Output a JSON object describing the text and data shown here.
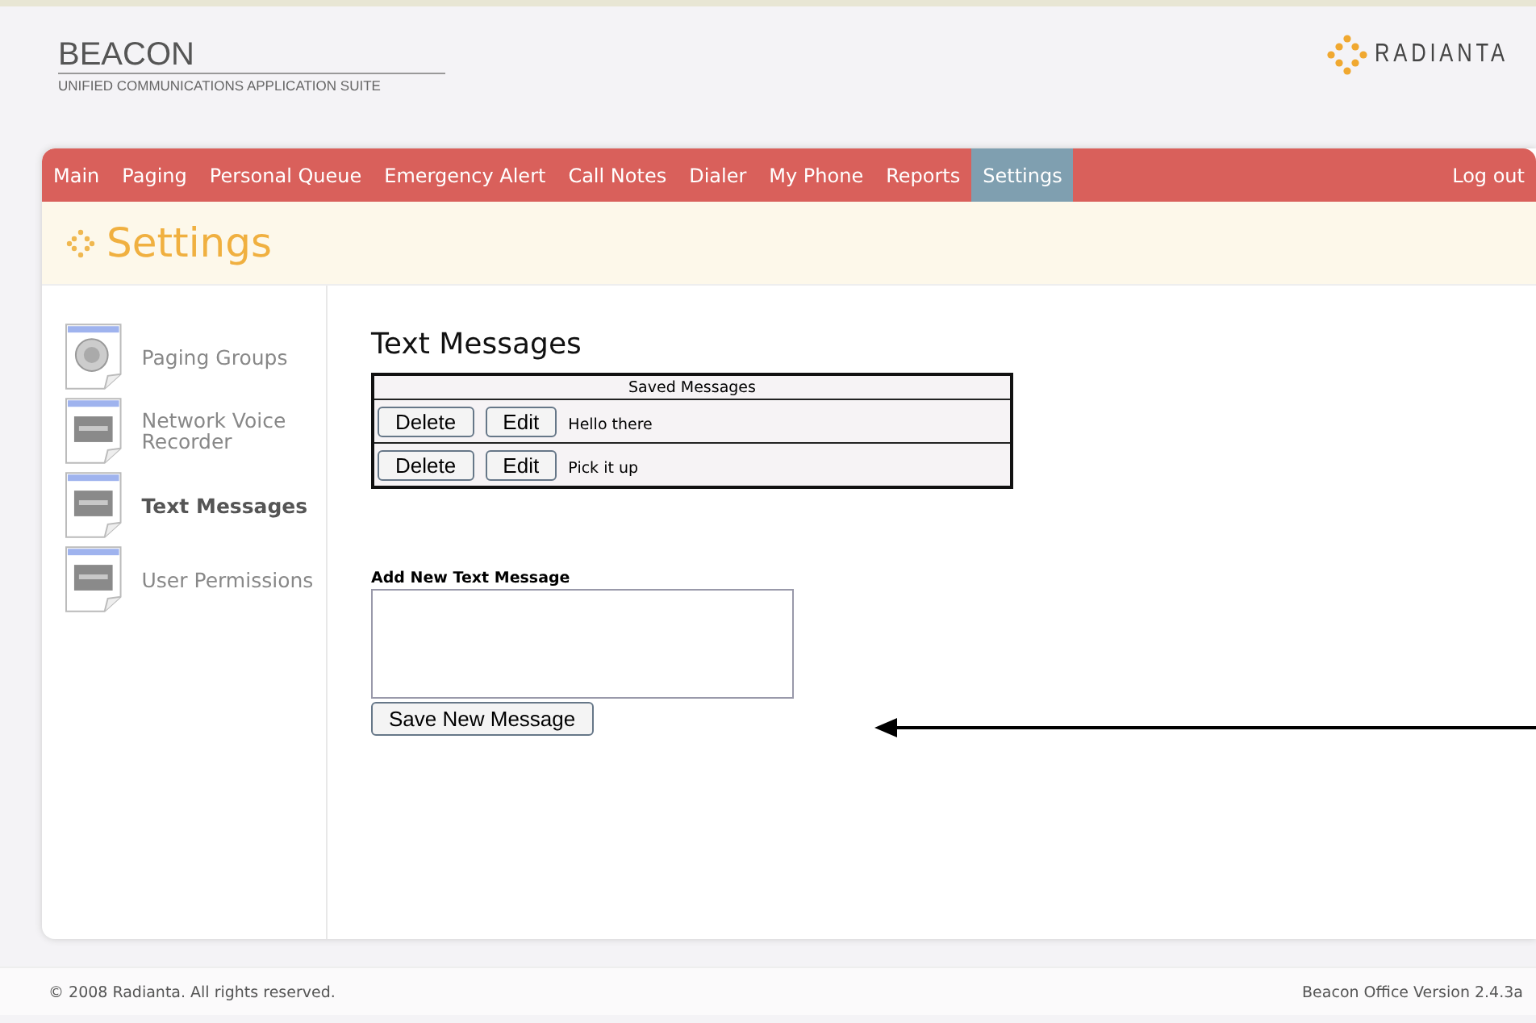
{
  "header": {
    "title": "BEACON",
    "subtitle": "UNIFIED COMMUNICATIONS APPLICATION SUITE",
    "brand": "RADIANTA"
  },
  "nav": [
    {
      "label": "Main",
      "selected": false
    },
    {
      "label": "Paging",
      "selected": false
    },
    {
      "label": "Personal Queue",
      "selected": false
    },
    {
      "label": "Emergency Alert",
      "selected": false
    },
    {
      "label": "Call Notes",
      "selected": false
    },
    {
      "label": "Dialer",
      "selected": false
    },
    {
      "label": "My Phone",
      "selected": false
    },
    {
      "label": "Reports",
      "selected": false
    },
    {
      "label": "Settings",
      "selected": true
    }
  ],
  "logout": "Log out",
  "page_title": "Settings",
  "sidebar": [
    {
      "label": "Paging Groups",
      "kind": "speaker",
      "selected": false
    },
    {
      "label": "Network Voice Recorder",
      "kind": "device",
      "selected": false
    },
    {
      "label": "Text Messages",
      "kind": "device",
      "selected": true
    },
    {
      "label": "User Permissions",
      "kind": "device",
      "selected": false
    }
  ],
  "content": {
    "title": "Text Messages",
    "table": {
      "heading": "Saved Messages",
      "rows": [
        {
          "delete": "Delete",
          "edit": "Edit",
          "text": "Hello there"
        },
        {
          "delete": "Delete",
          "edit": "Edit",
          "text": "Pick it up"
        }
      ]
    },
    "form_label": "Add New Text Message",
    "save_button": "Save New Message"
  },
  "footer": {
    "copyright": "© 2008 Radianta. All rights reserved.",
    "version": "Beacon Office Version 2.4.3a"
  }
}
